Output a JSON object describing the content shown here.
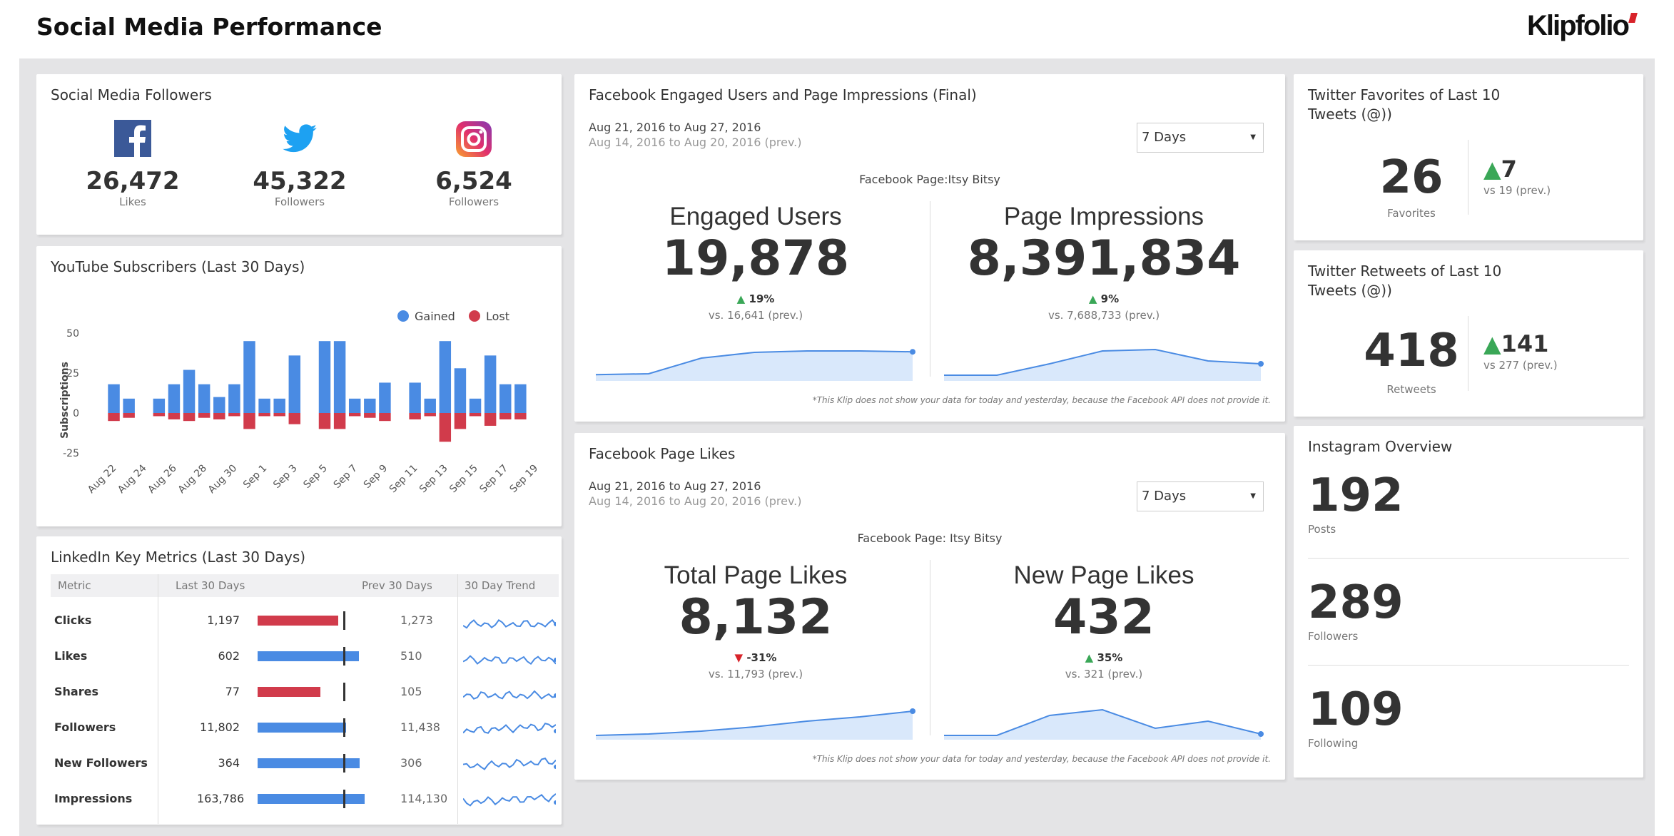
{
  "header": {
    "title": "Social Media Performance",
    "logo_text": "Klipfolio",
    "brand_color": "#d8232a"
  },
  "colors": {
    "accent_blue": "#4a8be3",
    "loss_red": "#d13b4b",
    "up_green": "#3aa757",
    "down_red": "#d8232a",
    "spark_fill": "#d9e8fb",
    "spark_line": "#4a8be3"
  },
  "followers": {
    "title": "Social Media Followers",
    "items": [
      {
        "icon": "facebook-icon",
        "value": "26,472",
        "label": "Likes",
        "color": "#3b5998"
      },
      {
        "icon": "twitter-icon",
        "value": "45,322",
        "label": "Followers",
        "color": "#1da1f2"
      },
      {
        "icon": "instagram-icon",
        "value": "6,524",
        "label": "Followers",
        "color": "#c13584"
      }
    ]
  },
  "youtube": {
    "title": "YouTube Subscribers (Last 30 Days)",
    "legend_gained": "Gained",
    "legend_lost": "Lost",
    "ylabel": "Subscriptions"
  },
  "chart_data": {
    "type": "bar",
    "title": "YouTube Subscribers (Last 30 Days)",
    "ylabel": "Subscriptions",
    "ylim": [
      -25,
      50
    ],
    "yticks": [
      50,
      25,
      0,
      -25
    ],
    "categories": [
      "Aug 22",
      "Aug 23",
      "Aug 24",
      "Aug 25",
      "Aug 26",
      "Aug 27",
      "Aug 28",
      "Aug 29",
      "Aug 30",
      "Aug 31",
      "Sep 1",
      "Sep 2",
      "Sep 3",
      "Sep 4",
      "Sep 5",
      "Sep 6",
      "Sep 7",
      "Sep 8",
      "Sep 9",
      "Sep 10",
      "Sep 11",
      "Sep 12",
      "Sep 13",
      "Sep 14",
      "Sep 15",
      "Sep 16",
      "Sep 17",
      "Sep 18",
      "Sep 19"
    ],
    "tick_labels": [
      "Aug 22",
      "Aug 24",
      "Aug 26",
      "Aug 28",
      "Aug 30",
      "Sep 1",
      "Sep 3",
      "Sep 5",
      "Sep 7",
      "Sep 9",
      "Sep 11",
      "Sep 13",
      "Sep 15",
      "Sep 17",
      "Sep 19"
    ],
    "series": [
      {
        "name": "Gained",
        "color": "#4a8be3",
        "values": [
          18,
          9,
          0,
          9,
          18,
          27,
          18,
          10,
          18,
          45,
          9,
          9,
          36,
          0,
          45,
          45,
          9,
          9,
          19,
          0,
          19,
          9,
          45,
          28,
          9,
          36,
          18,
          18,
          0
        ]
      },
      {
        "name": "Lost",
        "color": "#d13b4b",
        "values": [
          -5,
          -3,
          0,
          -2,
          -4,
          -5,
          -3,
          -4,
          -2,
          -10,
          -2,
          -2,
          -7,
          0,
          -10,
          -10,
          -2,
          -3,
          -5,
          0,
          -4,
          -2,
          -18,
          -10,
          -2,
          -8,
          -4,
          -4,
          0
        ]
      }
    ],
    "legend": "top-right",
    "grid": false
  },
  "linkedin": {
    "title": "LinkedIn Key Metrics (Last 30 Days)",
    "columns": [
      "Metric",
      "Last 30 Days",
      "Prev 30 Days",
      "30 Day Trend"
    ],
    "rows": [
      {
        "metric": "Clicks",
        "last": "1,197",
        "prev": "1,273",
        "ratio": 0.94,
        "status": "down"
      },
      {
        "metric": "Likes",
        "last": "602",
        "prev": "510",
        "ratio": 1.18,
        "status": "up"
      },
      {
        "metric": "Shares",
        "last": "77",
        "prev": "105",
        "ratio": 0.73,
        "status": "down"
      },
      {
        "metric": "Followers",
        "last": "11,802",
        "prev": "11,438",
        "ratio": 1.03,
        "status": "up"
      },
      {
        "metric": "New Followers",
        "last": "364",
        "prev": "306",
        "ratio": 1.19,
        "status": "up"
      },
      {
        "metric": "Impressions",
        "last": "163,786",
        "prev": "114,130",
        "ratio": 1.44,
        "status": "up"
      }
    ]
  },
  "fb_engaged": {
    "title": "Facebook Engaged Users and Page Impressions (Final)",
    "range_current": "Aug 21, 2016 to Aug 27, 2016",
    "range_prev": "Aug 14, 2016 to Aug 20, 2016 (prev.)",
    "select_value": "7 Days",
    "page_label": "Facebook Page:Itsy Bitsy",
    "footnote": "*This Klip does not show your data for today and yesterday, because the Facebook API does not provide it.",
    "metrics": [
      {
        "label": "Engaged Users",
        "value": "19,878",
        "change": "19%",
        "direction": "up",
        "prev": "vs. 16,641 (prev.)",
        "spark": [
          0.12,
          0.15,
          0.7,
          0.9,
          0.95,
          0.95,
          0.92
        ]
      },
      {
        "label": "Page Impressions",
        "value": "8,391,834",
        "change": "9%",
        "direction": "up",
        "prev": "vs. 7,688,733 (prev.)",
        "spark": [
          0.1,
          0.1,
          0.5,
          0.95,
          1.0,
          0.6,
          0.5
        ]
      }
    ]
  },
  "fb_likes": {
    "title": "Facebook Page Likes",
    "range_current": "Aug 21, 2016 to Aug 27, 2016",
    "range_prev": "Aug 14, 2016 to Aug 20, 2016 (prev.)",
    "select_value": "7 Days",
    "page_label": "Facebook Page: Itsy Bitsy",
    "footnote": "*This Klip does not show your data for today and yesterday, because the Facebook API does not provide it.",
    "metrics": [
      {
        "label": "Total Page Likes",
        "value": "8,132",
        "change": "-31%",
        "direction": "down",
        "prev": "vs. 11,793 (prev.)",
        "spark": [
          0.05,
          0.1,
          0.2,
          0.35,
          0.55,
          0.7,
          0.9
        ]
      },
      {
        "label": "New Page Likes",
        "value": "432",
        "change": "35%",
        "direction": "up",
        "prev": "vs. 321 (prev.)",
        "spark": [
          0.05,
          0.05,
          0.75,
          0.95,
          0.3,
          0.55,
          0.1
        ]
      }
    ]
  },
  "tw_fav": {
    "title": "Twitter Favorites of Last 10 Tweets (@))",
    "value": "26",
    "label": "Favorites",
    "change": "7",
    "prev": "vs 19 (prev.)"
  },
  "tw_rt": {
    "title": "Twitter Retweets of Last 10 Tweets (@))",
    "value": "418",
    "label": "Retweets",
    "change": "141",
    "prev": "vs 277 (prev.)"
  },
  "instagram": {
    "title": "Instagram Overview",
    "stats": [
      {
        "value": "192",
        "label": "Posts"
      },
      {
        "value": "289",
        "label": "Followers"
      },
      {
        "value": "109",
        "label": "Following"
      }
    ]
  }
}
